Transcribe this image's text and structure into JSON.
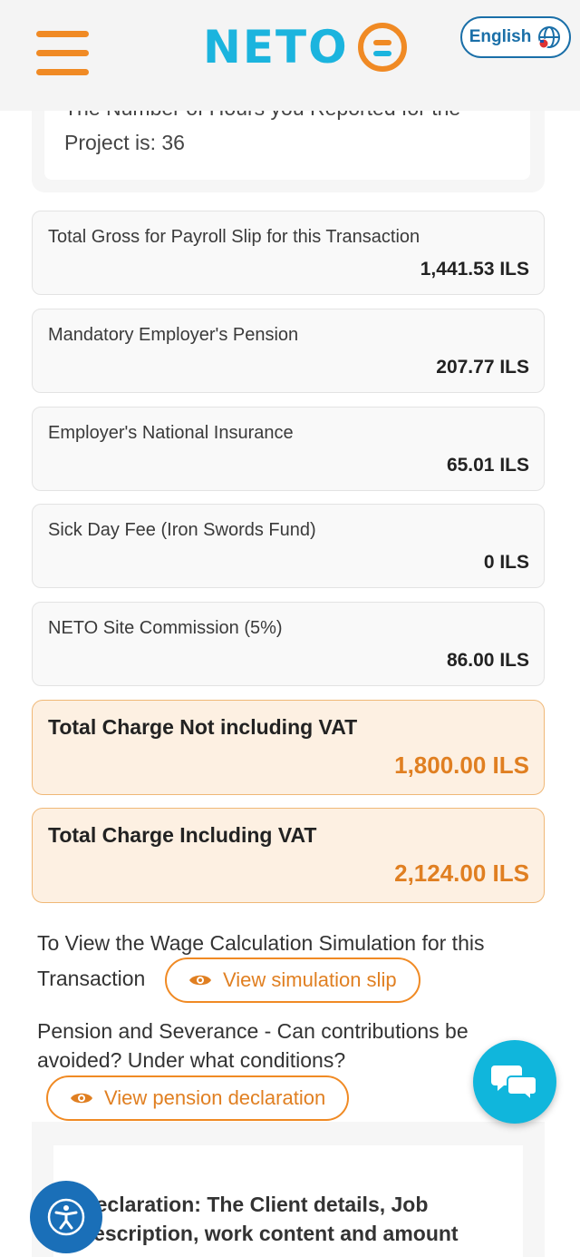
{
  "header": {
    "logo_text": "NETO",
    "language_label": "English"
  },
  "hours_card": {
    "line1": "The Number of Hours you Reported for the",
    "line2": "Project is: 36"
  },
  "rows": [
    {
      "label": "Total Gross for Payroll Slip for this Transaction",
      "value": "1,441.53 ILS"
    },
    {
      "label": "Mandatory Employer's Pension",
      "value": "207.77 ILS"
    },
    {
      "label": "Employer's National Insurance",
      "value": "65.01 ILS"
    },
    {
      "label": "Sick Day Fee (Iron Swords Fund)",
      "value": "0 ILS"
    },
    {
      "label": "NETO Site Commission (5%)",
      "value": "86.00 ILS"
    }
  ],
  "totals": [
    {
      "label": "Total Charge Not including VAT",
      "value": "1,800.00 ILS"
    },
    {
      "label": "Total Charge Including VAT",
      "value": "2,124.00 ILS"
    }
  ],
  "simulation": {
    "line1": "To View the Wage Calculation Simulation for this",
    "line2": "Transaction",
    "button_label": "View simulation slip"
  },
  "pension": {
    "line1": "Pension and Severance - Can contributions be",
    "line2": "avoided? Under what conditions?",
    "button_label": "View pension declaration"
  },
  "declaration": {
    "line1": "Declaration: The Client details, Job",
    "line2": "description, work content and amount"
  },
  "colors": {
    "brand_blue": "#1bb4de",
    "brand_orange": "#f08a24",
    "accent_dark_blue": "#1a6fa8"
  },
  "icons": {
    "menu": "hamburger-menu-icon",
    "language": "globe-icon",
    "view": "eye-icon",
    "chat": "chat-bubbles-icon",
    "accessibility": "accessibility-icon"
  }
}
